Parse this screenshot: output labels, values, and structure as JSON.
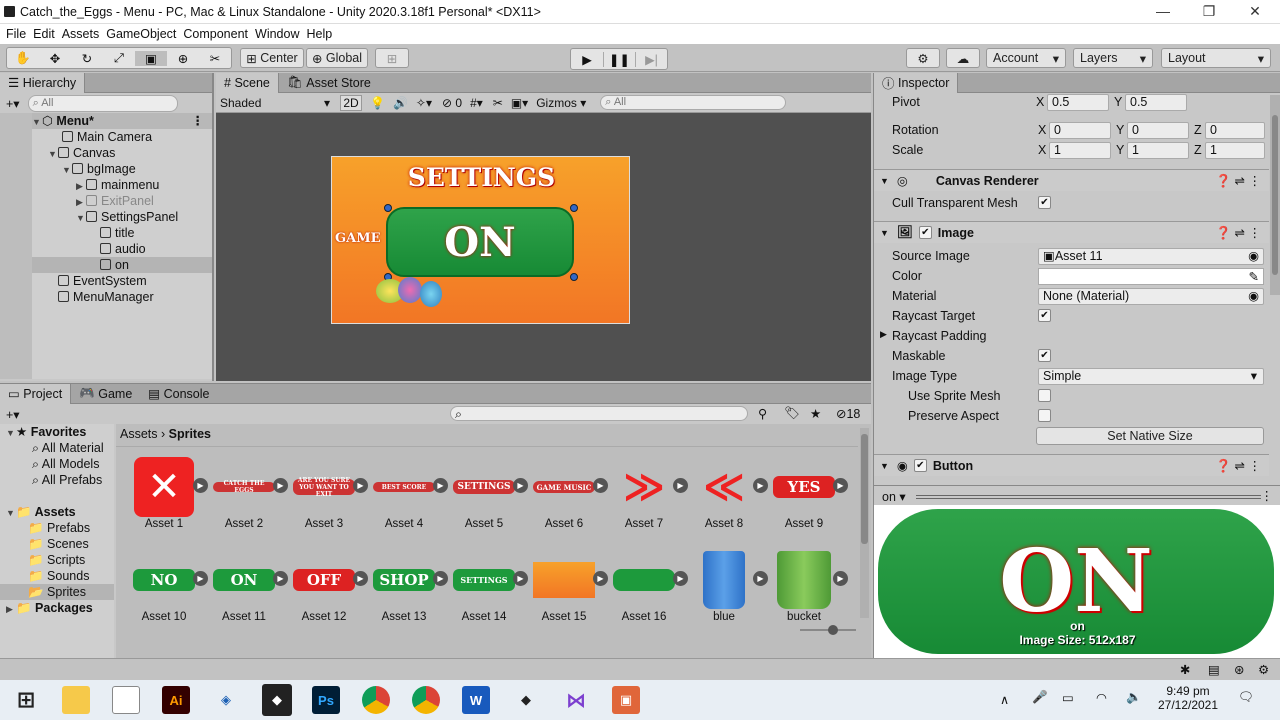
{
  "window": {
    "title": "Catch_the_Eggs - Menu - PC, Mac & Linux Standalone - Unity 2020.3.18f1 Personal* <DX11>",
    "minimize": "—",
    "restore": "❐",
    "close": "✕"
  },
  "menu": [
    "File",
    "Edit",
    "Assets",
    "GameObject",
    "Component",
    "Window",
    "Help"
  ],
  "toolbar": {
    "pivot": "Center",
    "space": "Global",
    "account": "Account",
    "layers": "Layers",
    "layout": "Layout"
  },
  "hierarchy": {
    "tab": "Hierarchy",
    "search": "All",
    "scene": "Menu*",
    "items": [
      "Main Camera",
      "Canvas",
      "bgImage",
      "mainmenu",
      "ExitPanel",
      "SettingsPanel",
      "title",
      "audio",
      "on",
      "EventSystem",
      "MenuManager"
    ]
  },
  "scene": {
    "tab": "Scene",
    "tab2": "Asset Store",
    "shading": "Shaded",
    "mode2d": "2D",
    "hidden": "0",
    "gizmos": "Gizmos",
    "search": "All",
    "settings": "SETTINGS",
    "on": "ON",
    "game": "GAME"
  },
  "project": {
    "tabs": [
      "Project",
      "Game",
      "Console"
    ],
    "hidden_count": "18",
    "favorites": "Favorites",
    "fav_items": [
      "All Material",
      "All Models",
      "All Prefabs"
    ],
    "assets": "Assets",
    "folders": [
      "Prefabs",
      "Scenes",
      "Scripts",
      "Sounds",
      "Sprites"
    ],
    "packages": "Packages",
    "breadcrumb": [
      "Assets",
      "Sprites"
    ],
    "row1": [
      {
        "name": "Asset 1"
      },
      {
        "name": "Asset 2"
      },
      {
        "name": "Asset 3"
      },
      {
        "name": "Asset 4"
      },
      {
        "name": "Asset 5"
      },
      {
        "name": "Asset 6"
      },
      {
        "name": "Asset 7"
      },
      {
        "name": "Asset 8"
      },
      {
        "name": "Asset 9"
      }
    ],
    "row2": [
      {
        "name": "Asset 10"
      },
      {
        "name": "Asset 11"
      },
      {
        "name": "Asset 12"
      },
      {
        "name": "Asset 13"
      },
      {
        "name": "Asset 14"
      },
      {
        "name": "Asset 15"
      },
      {
        "name": "Asset 16"
      },
      {
        "name": "blue"
      },
      {
        "name": "bucket"
      }
    ],
    "thumb_text": {
      "settings": "SETTINGS",
      "game_music": "GAME MUSIC",
      "yes": "YES",
      "no": "NO",
      "on": "ON",
      "off": "OFF",
      "shop": "SHOP",
      "settings_small": "SETTINGS",
      "t2": "CATCH THE EGGS",
      "t3": "ARE YOU SURE YOU WANT TO EXIT",
      "t4": "BEST SCORE"
    }
  },
  "inspector": {
    "tab": "Inspector",
    "pivot": {
      "label": "Pivot",
      "x": "0.5",
      "y": "0.5"
    },
    "rotation": {
      "label": "Rotation",
      "x": "0",
      "y": "0",
      "z": "0"
    },
    "scale": {
      "label": "Scale",
      "x": "1",
      "y": "1",
      "z": "1"
    },
    "canvas_renderer": "Canvas Renderer",
    "cull": "Cull Transparent Mesh",
    "image": "Image",
    "source_image": "Source Image",
    "source_value": "Asset 11",
    "color": "Color",
    "material": "Material",
    "material_value": "None (Material)",
    "raycast_target": "Raycast Target",
    "raycast_padding": "Raycast Padding",
    "maskable": "Maskable",
    "image_type": "Image Type",
    "image_type_value": "Simple",
    "use_sprite_mesh": "Use Sprite Mesh",
    "preserve_aspect": "Preserve Aspect",
    "set_native": "Set Native Size",
    "button": "Button",
    "preview_name": "on",
    "preview_label": "on",
    "image_size": "Image Size: 512x187",
    "preview_text": "ON"
  },
  "taskbar": {
    "time": "9:49 pm",
    "date": "27/12/2021"
  }
}
